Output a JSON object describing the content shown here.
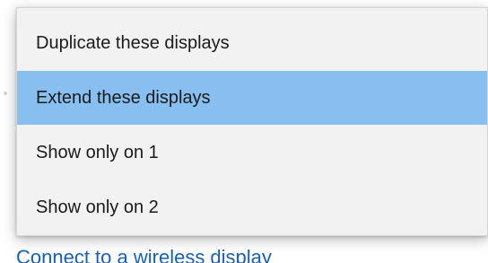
{
  "menu": {
    "items": [
      {
        "label": "Duplicate these displays",
        "selected": false
      },
      {
        "label": "Extend these displays",
        "selected": true
      },
      {
        "label": "Show only on 1",
        "selected": false
      },
      {
        "label": "Show only on 2",
        "selected": false
      }
    ]
  },
  "link": {
    "label": "Connect to a wireless display"
  },
  "colors": {
    "menu_background": "#f2f2f2",
    "selected_background": "#86bff0",
    "link": "#1a5fb4",
    "text": "#1a1a1a"
  }
}
